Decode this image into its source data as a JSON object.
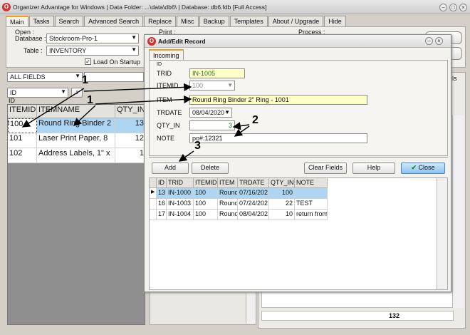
{
  "window": {
    "title": "Organizer Advantage for Windows | Data Folder: ...\\data\\db6\\ | Database: db6.fdb [Full Access]"
  },
  "tabs": [
    "Main",
    "Tasks",
    "Search",
    "Advanced Search",
    "Replace",
    "Misc",
    "Backup",
    "Templates",
    "About / Upgrade",
    "Hide"
  ],
  "open": {
    "group_label": "Open :",
    "database_label": "Database :",
    "database_value": "Stockroom-Pro-1",
    "table_label": "Table :",
    "table_value": "INVENTORY",
    "load_on_startup": "Load On Startup"
  },
  "print_label": "Print :",
  "process_label": "Process :",
  "filter": {
    "field": "ALL FIELDS",
    "sort_field": "ID",
    "sort_sub": "ID"
  },
  "main_grid": {
    "columns": [
      "ITEMID",
      "ITEMNAME",
      "QTY_IN"
    ],
    "rows": [
      {
        "id": "100",
        "name": "Round Ring Binder 2",
        "qty": "13",
        "selected": true
      },
      {
        "id": "101",
        "name": "Laser Print Paper, 8",
        "qty": "12",
        "selected": false
      },
      {
        "id": "102",
        "name": "Address Labels, 1\" x",
        "qty": "1",
        "selected": false
      }
    ]
  },
  "right_panel": {
    "panels_label": "nels",
    "total": "132"
  },
  "dialog": {
    "title": "Add/Edit Record",
    "tab": "Incoming",
    "id_label": "ID",
    "trid_label": "TRID",
    "trid_value": "IN-1005",
    "itemid_label": "ITEMID",
    "itemid_value": "100",
    "item_label": "ITEM",
    "item_value": "Round Ring Binder 2\" Ring - 1001",
    "trdate_label": "TRDATE",
    "trdate_value": "08/04/2020",
    "qty_label": "QTY_IN",
    "qty_value": "3",
    "note_label": "NOTE",
    "note_value": "po#:12321",
    "buttons": {
      "add": "Add",
      "delete": "Delete",
      "clear": "Clear Fields",
      "help": "Help",
      "close": "Close"
    },
    "grid": {
      "columns": [
        "ID",
        "TRID",
        "ITEMID",
        "ITEM",
        "TRDATE",
        "QTY_IN",
        "NOTE"
      ],
      "rows": [
        [
          "13",
          "IN-1000",
          "100",
          "Round",
          "07/16/202",
          "100",
          ""
        ],
        [
          "16",
          "IN-1003",
          "100",
          "Round",
          "07/24/202",
          "22",
          "TEST"
        ],
        [
          "17",
          "IN-1004",
          "100",
          "Round",
          "08/04/202",
          "10",
          "return from"
        ]
      ]
    }
  },
  "annotations": [
    "1",
    "1",
    "2",
    "3"
  ],
  "colors": {
    "selected_row": "#aed6f3",
    "highlight_field": "#ffffc8",
    "accent_tab": "#f0a020"
  }
}
